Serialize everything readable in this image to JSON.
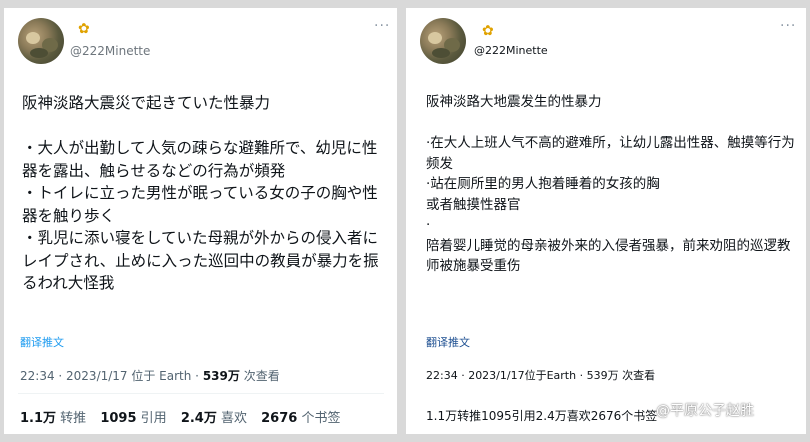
{
  "left": {
    "handle": "@222Minette",
    "more": "···",
    "body": "阪神淡路大震災で起きていた性暴力\n\n・大人が出勤して人気の疎らな避難所で、幼児に性器を露出、触らせるなどの行為が頻発\n・トイレに立った男性が眠っている女の子の胸や性器を触り歩く\n・乳児に添い寝をしていた母親が外からの侵入者にレイプされ、止めに入った巡回中の教員が暴力を振るわれ大怪我",
    "translate": "翻译推文",
    "meta_time": "22:34 · 2023/1/17 位于 Earth · ",
    "meta_views": "539万",
    "meta_views_suffix": " 次查看",
    "stats": [
      {
        "value": "1.1万",
        "label": "转推"
      },
      {
        "value": "1095",
        "label": "引用"
      },
      {
        "value": "2.4万",
        "label": "喜欢"
      },
      {
        "value": "2676",
        "label": "个书签"
      }
    ]
  },
  "right": {
    "handle": "@222Minette",
    "more": "···",
    "body": "阪神淡路大地震发生的性暴力\n\n·在大人上班人气不高的避难所，让幼儿露出性器、触摸等行为频发\n·站在厕所里的男人抱着睡着的女孩的胸\n或者触摸性器官\n·\n陪着婴儿睡觉的母亲被外来的入侵者强暴，前来劝阻的巡逻教师被施暴受重伤",
    "translate": "翻译推文",
    "meta": "22:34 · 2023/1/17位于Earth · 539万 次查看",
    "stats": "1.1万转推1095引用2.4万喜欢2676个书签"
  },
  "watermark": "@平原公子赵胜"
}
